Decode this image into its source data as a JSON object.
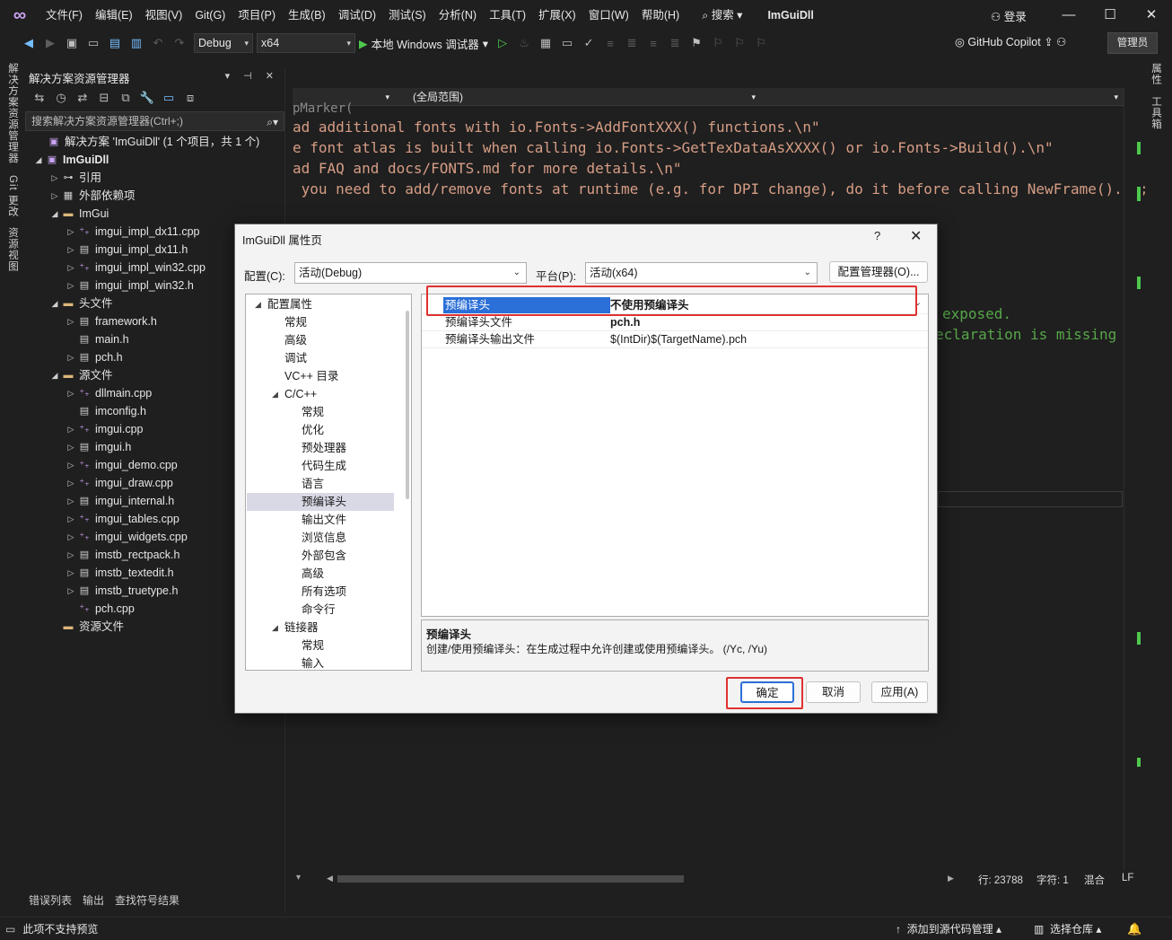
{
  "menu": {
    "items": [
      "文件(F)",
      "编辑(E)",
      "视图(V)",
      "Git(G)",
      "项目(P)",
      "生成(B)",
      "调试(D)",
      "测试(S)",
      "分析(N)",
      "工具(T)",
      "扩展(X)",
      "窗口(W)",
      "帮助(H)"
    ],
    "search": "搜索",
    "title": "ImGuiDll",
    "login": "登录"
  },
  "toolbar": {
    "config": "Debug",
    "platform": "x64",
    "run_label": "本地 Windows 调试器",
    "copilot": "GitHub Copilot",
    "admin": "管理员"
  },
  "left_strip": [
    "解决方案资源管理器",
    "Git 更改",
    "资源视图"
  ],
  "right_strip": [
    "属性",
    "工具箱"
  ],
  "solution_explorer": {
    "title": "解决方案资源管理器",
    "search_placeholder": "搜索解决方案资源管理器(Ctrl+;)",
    "tree": [
      {
        "label": "解决方案 'ImGuiDll' (1 个项目，共 1 个)",
        "icon": "solution-icon",
        "depth": 0,
        "twisty": ""
      },
      {
        "label": "ImGuiDll",
        "icon": "project-icon",
        "depth": 0,
        "twisty": "open",
        "bold": true
      },
      {
        "label": "引用",
        "icon": "reference-icon",
        "depth": 1,
        "twisty": "closed"
      },
      {
        "label": "外部依赖项",
        "icon": "external-deps-icon",
        "depth": 1,
        "twisty": "closed"
      },
      {
        "label": "ImGui",
        "icon": "filter-folder-icon",
        "depth": 1,
        "twisty": "open"
      },
      {
        "label": "imgui_impl_dx11.cpp",
        "icon": "cpp-file-icon",
        "depth": 2,
        "twisty": "closed"
      },
      {
        "label": "imgui_impl_dx11.h",
        "icon": "header-file-icon",
        "depth": 2,
        "twisty": "closed"
      },
      {
        "label": "imgui_impl_win32.cpp",
        "icon": "cpp-file-icon",
        "depth": 2,
        "twisty": "closed"
      },
      {
        "label": "imgui_impl_win32.h",
        "icon": "header-file-icon",
        "depth": 2,
        "twisty": "closed"
      },
      {
        "label": "头文件",
        "icon": "filter-folder-icon",
        "depth": 1,
        "twisty": "open"
      },
      {
        "label": "framework.h",
        "icon": "header-file-icon",
        "depth": 2,
        "twisty": "closed"
      },
      {
        "label": "main.h",
        "icon": "header-file-icon",
        "depth": 2,
        "twisty": ""
      },
      {
        "label": "pch.h",
        "icon": "header-file-icon",
        "depth": 2,
        "twisty": "closed"
      },
      {
        "label": "源文件",
        "icon": "filter-folder-icon",
        "depth": 1,
        "twisty": "open"
      },
      {
        "label": "dllmain.cpp",
        "icon": "cpp-file-icon",
        "depth": 2,
        "twisty": "closed"
      },
      {
        "label": "imconfig.h",
        "icon": "header-file-icon",
        "depth": 2,
        "twisty": ""
      },
      {
        "label": "imgui.cpp",
        "icon": "cpp-file-icon",
        "depth": 2,
        "twisty": "closed"
      },
      {
        "label": "imgui.h",
        "icon": "header-file-icon",
        "depth": 2,
        "twisty": "closed"
      },
      {
        "label": "imgui_demo.cpp",
        "icon": "cpp-file-icon",
        "depth": 2,
        "twisty": "closed"
      },
      {
        "label": "imgui_draw.cpp",
        "icon": "cpp-file-icon",
        "depth": 2,
        "twisty": "closed"
      },
      {
        "label": "imgui_internal.h",
        "icon": "header-file-icon",
        "depth": 2,
        "twisty": "closed"
      },
      {
        "label": "imgui_tables.cpp",
        "icon": "cpp-file-icon",
        "depth": 2,
        "twisty": "closed"
      },
      {
        "label": "imgui_widgets.cpp",
        "icon": "cpp-file-icon",
        "depth": 2,
        "twisty": "closed"
      },
      {
        "label": "imstb_rectpack.h",
        "icon": "header-file-icon",
        "depth": 2,
        "twisty": "closed"
      },
      {
        "label": "imstb_textedit.h",
        "icon": "header-file-icon",
        "depth": 2,
        "twisty": "closed"
      },
      {
        "label": "imstb_truetype.h",
        "icon": "header-file-icon",
        "depth": 2,
        "twisty": "closed"
      },
      {
        "label": "pch.cpp",
        "icon": "cpp-file-icon",
        "depth": 2,
        "twisty": ""
      },
      {
        "label": "资源文件",
        "icon": "filter-folder-icon",
        "depth": 1,
        "twisty": ""
      }
    ]
  },
  "editor": {
    "nav_scope": "(全局范围)",
    "code_lines": [
      {
        "text": "pMarker(",
        "cls": ""
      },
      {
        "text": "ad additional fonts with io.Fonts->AddFontXXX() functions.\\n\"",
        "cls": ""
      },
      {
        "text": "e font atlas is built when calling io.Fonts->GetTexDataAsXXXX() or io.Fonts->Build().\\n\"",
        "cls": ""
      },
      {
        "text": "ad FAQ and docs/FONTS.md for more details.\\n\"",
        "cls": ""
      },
      {
        "text": " you need to add/remove fonts at runtime (e.g. for DPI change), do it before calling NewFrame().\");",
        "cls": ""
      }
    ],
    "right_frag_1": "exposed.",
    "right_frag_2": "eclaration is missing f",
    "status": {
      "line": "行: 23788",
      "char": "字符: 1",
      "mixed": "混合",
      "eol": "LF"
    }
  },
  "bottom_tabs": [
    "错误列表",
    "输出",
    "查找符号结果"
  ],
  "statusbar": {
    "left": "此项不支持预览",
    "source_control": "添加到源代码管理",
    "repo": "选择仓库"
  },
  "dialog": {
    "title": "ImGuiDll 属性页",
    "help": "?",
    "config_label": "配置(C):",
    "config_value": "活动(Debug)",
    "platform_label": "平台(P):",
    "platform_value": "活动(x64)",
    "config_manager": "配置管理器(O)...",
    "tree": [
      {
        "label": "配置属性",
        "depth": 0,
        "twisty": "open"
      },
      {
        "label": "常规",
        "depth": 1
      },
      {
        "label": "高级",
        "depth": 1
      },
      {
        "label": "调试",
        "depth": 1
      },
      {
        "label": "VC++ 目录",
        "depth": 1
      },
      {
        "label": "C/C++",
        "depth": 1,
        "twisty": "open"
      },
      {
        "label": "常规",
        "depth": 2
      },
      {
        "label": "优化",
        "depth": 2
      },
      {
        "label": "预处理器",
        "depth": 2
      },
      {
        "label": "代码生成",
        "depth": 2
      },
      {
        "label": "语言",
        "depth": 2
      },
      {
        "label": "预编译头",
        "depth": 2,
        "selected": true
      },
      {
        "label": "输出文件",
        "depth": 2
      },
      {
        "label": "浏览信息",
        "depth": 2
      },
      {
        "label": "外部包含",
        "depth": 2
      },
      {
        "label": "高级",
        "depth": 2
      },
      {
        "label": "所有选项",
        "depth": 2
      },
      {
        "label": "命令行",
        "depth": 2
      },
      {
        "label": "链接器",
        "depth": 1,
        "twisty": "open"
      },
      {
        "label": "常规",
        "depth": 2
      },
      {
        "label": "输入",
        "depth": 2
      }
    ],
    "properties": [
      {
        "name": "预编译头",
        "value": "不使用预编译头",
        "selected": true
      },
      {
        "name": "预编译头文件",
        "value": "pch.h",
        "bold": true
      },
      {
        "name": "预编译头输出文件",
        "value": "$(IntDir)$(TargetName).pch"
      }
    ],
    "desc_title": "预编译头",
    "desc_text": "创建/使用预编译头：在生成过程中允许创建或使用预编译头。      (/Yc, /Yu)",
    "ok": "确定",
    "cancel": "取消",
    "apply": "应用(A)"
  }
}
